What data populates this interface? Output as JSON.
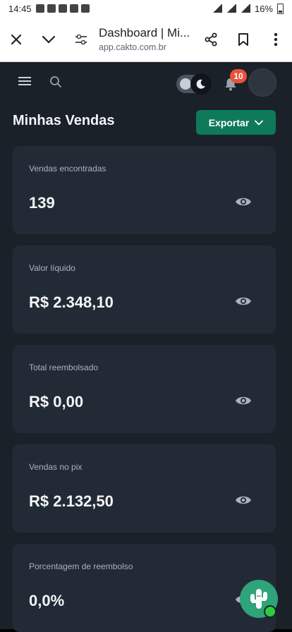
{
  "status_bar": {
    "time": "14:45",
    "battery": "16%"
  },
  "browser": {
    "page_title": "Dashboard | Mi...",
    "domain": "app.cakto.com.br"
  },
  "app": {
    "notification_count": "10",
    "heading": "Minhas Vendas",
    "export_label": "Exportar",
    "cards": [
      {
        "label": "Vendas encontradas",
        "value": "139"
      },
      {
        "label": "Valor líquido",
        "value": "R$ 2.348,10"
      },
      {
        "label": "Total reembolsado",
        "value": "R$ 0,00"
      },
      {
        "label": "Vendas no pix",
        "value": "R$ 2.132,50"
      },
      {
        "label": "Porcentagem de reembolso",
        "value": "0,0%"
      }
    ]
  },
  "colors": {
    "background": "#1a2129",
    "card": "#222b35",
    "accent": "#0e7a5a",
    "badge": "#e9523b"
  }
}
